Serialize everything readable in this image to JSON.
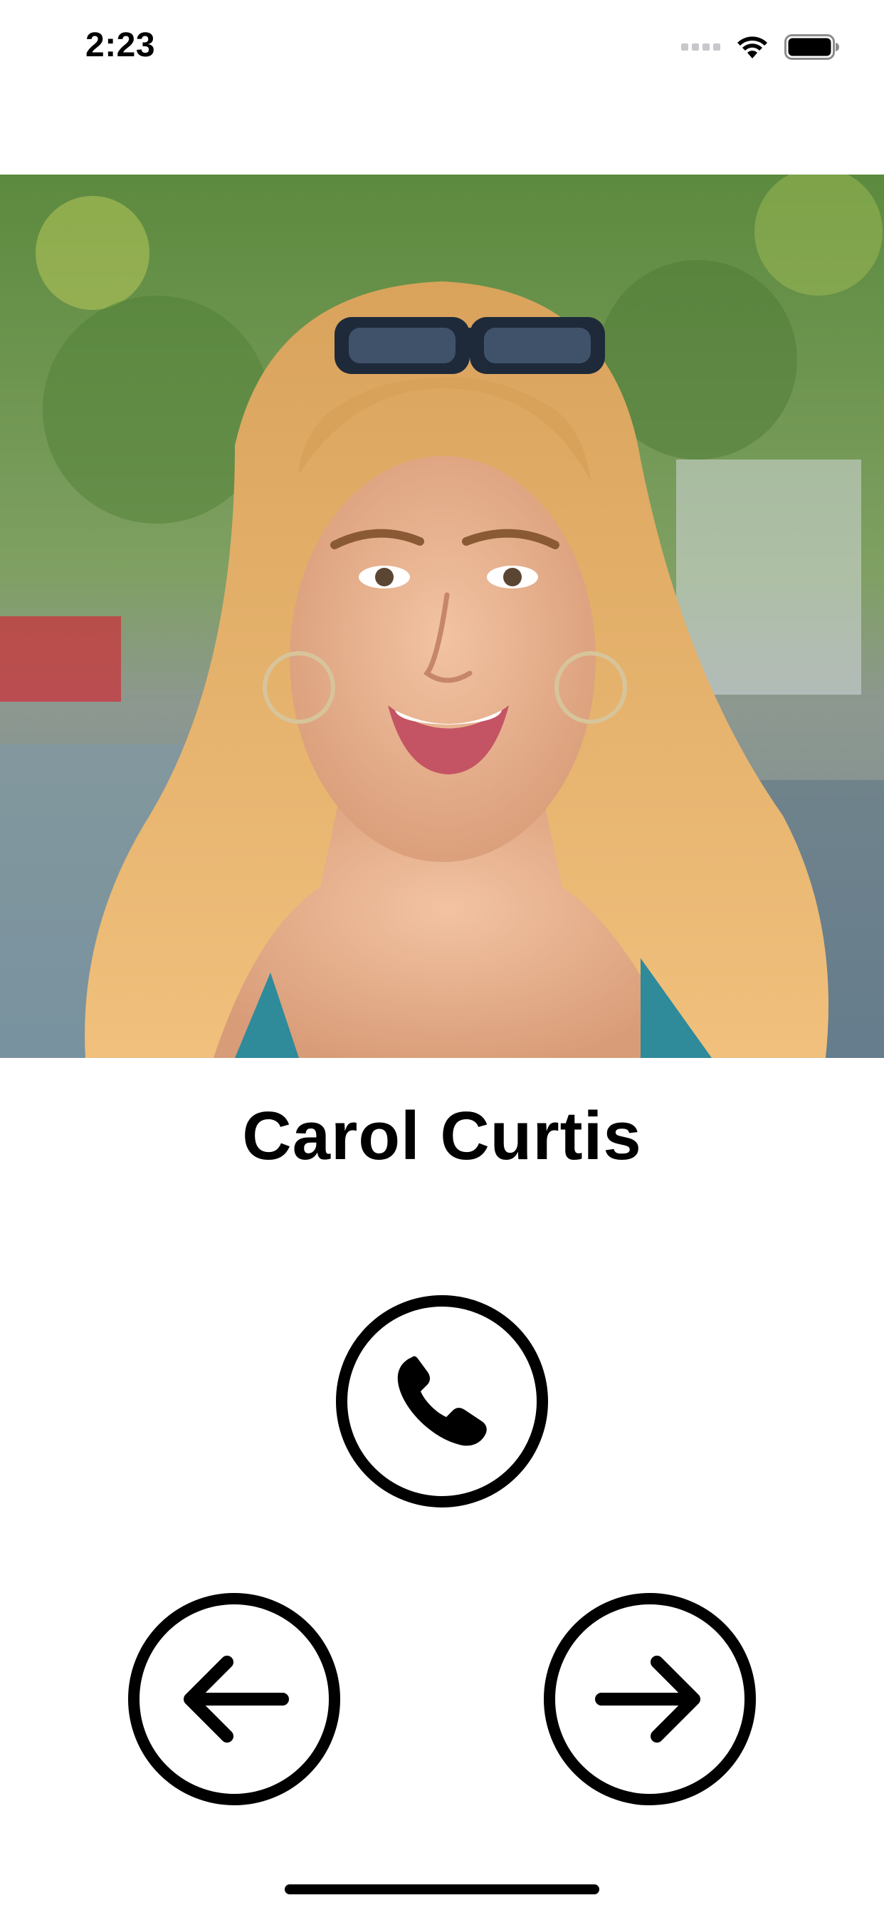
{
  "status_bar": {
    "time": "2:23"
  },
  "contact": {
    "name": "Carol Curtis",
    "photo_alt": "Contact photo"
  },
  "icons": {
    "call": "phone-icon",
    "previous": "arrow-left-icon",
    "next": "arrow-right-icon",
    "wifi": "wifi-icon",
    "battery": "battery-icon",
    "signal": "cellular-signal-icon"
  },
  "colors": {
    "foreground": "#000000",
    "background": "#ffffff",
    "signal_inactive": "#c7c7cc"
  }
}
